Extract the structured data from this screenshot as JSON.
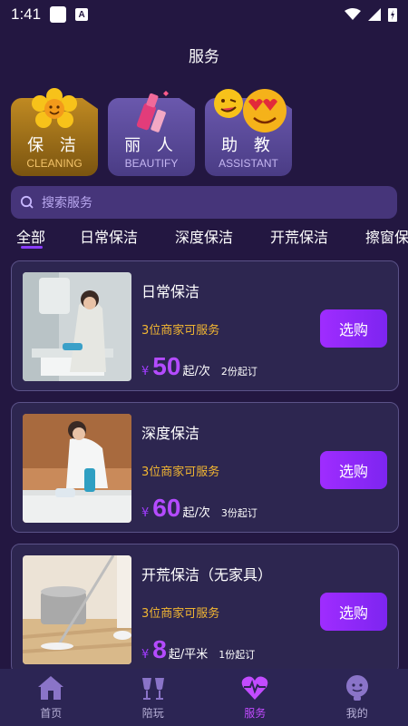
{
  "status_bar": {
    "time": "1:41"
  },
  "page": {
    "title": "服务"
  },
  "categories": [
    {
      "zh": "保 洁",
      "en": "CLEANING"
    },
    {
      "zh": "丽 人",
      "en": "BEAUTIFY"
    },
    {
      "zh": "助 教",
      "en": "ASSISTANT"
    }
  ],
  "search": {
    "placeholder": "搜索服务"
  },
  "tabs": [
    "全部",
    "日常保洁",
    "深度保洁",
    "开荒保洁",
    "擦窗保"
  ],
  "services": [
    {
      "name": "日常保洁",
      "vendors": "3位商家可服务",
      "yen": "¥",
      "price": "50",
      "unit": "起/次",
      "min_order": "2份起订",
      "buy_label": "选购"
    },
    {
      "name": "深度保洁",
      "vendors": "3位商家可服务",
      "yen": "¥",
      "price": "60",
      "unit": "起/次",
      "min_order": "3份起订",
      "buy_label": "选购"
    },
    {
      "name": "开荒保洁（无家具）",
      "vendors": "3位商家可服务",
      "yen": "¥",
      "price": "8",
      "unit": "起/平米",
      "min_order": "1份起订",
      "buy_label": "选购"
    }
  ],
  "bottom_nav": [
    {
      "label": "首页",
      "icon": "home-icon"
    },
    {
      "label": "陪玩",
      "icon": "cheers-icon"
    },
    {
      "label": "服务",
      "icon": "heart-pulse-icon",
      "active": true
    },
    {
      "label": "我的",
      "icon": "profile-icon"
    }
  ],
  "colors": {
    "background": "#231741",
    "accent": "#a13bff",
    "vendor_text": "#f2b632",
    "card": "#2d2650",
    "cleaning_card": "#b07d1c",
    "beautify_card": "#5a4a96"
  }
}
